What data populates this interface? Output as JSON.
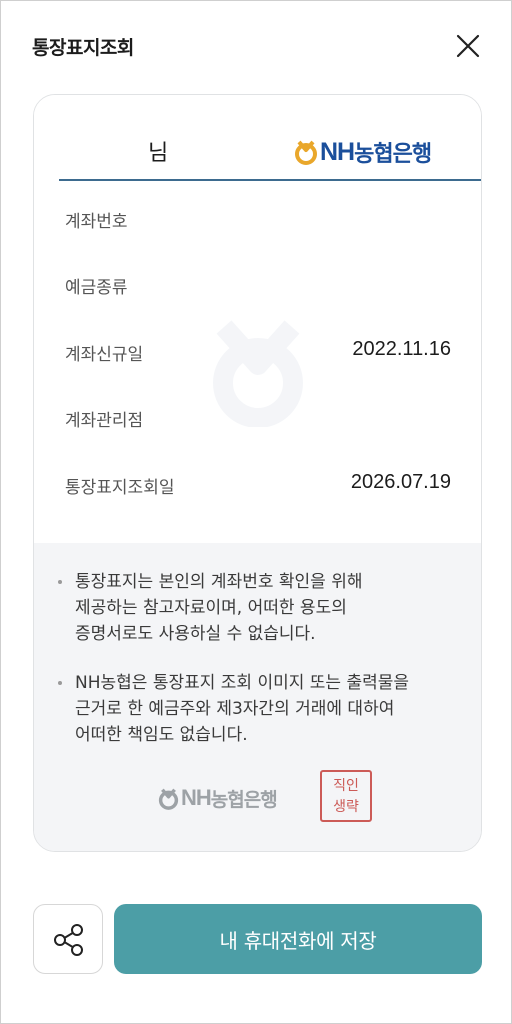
{
  "header": {
    "title": "통장표지조회",
    "close_icon": "close-icon"
  },
  "card": {
    "holder_suffix": "님",
    "bank_logo": {
      "latin": "NH",
      "korean": "농협은행",
      "color": "#1b4f9b"
    },
    "rows": [
      {
        "label": "계좌번호",
        "value": ""
      },
      {
        "label": "예금종류",
        "value": ""
      },
      {
        "label": "계좌신규일",
        "value": "2022.11.16"
      },
      {
        "label": "계좌관리점",
        "value": ""
      },
      {
        "label": "통장표지조회일",
        "value": "2026.07.19"
      }
    ],
    "notices": [
      "통장표지는 본인의 계좌번호 확인을 위해\n제공하는 참고자료이며, 어떠한 용도의\n증명서로도 사용하실 수 없습니다.",
      "NH농협은 통장표지 조회 이미지 또는 출력물을\n근거로 한 예금주와 제3자간의 거래에 대하여\n어떠한 책임도 없습니다."
    ],
    "footer_logo": {
      "latin": "NH",
      "korean": "농협은행"
    },
    "stamp": {
      "line1": "직인",
      "line2": "생략",
      "color": "#cc5b57"
    }
  },
  "actions": {
    "share_icon": "share-icon",
    "save_label": "내 휴대전화에 저장",
    "accent": "#4c9ea6"
  }
}
